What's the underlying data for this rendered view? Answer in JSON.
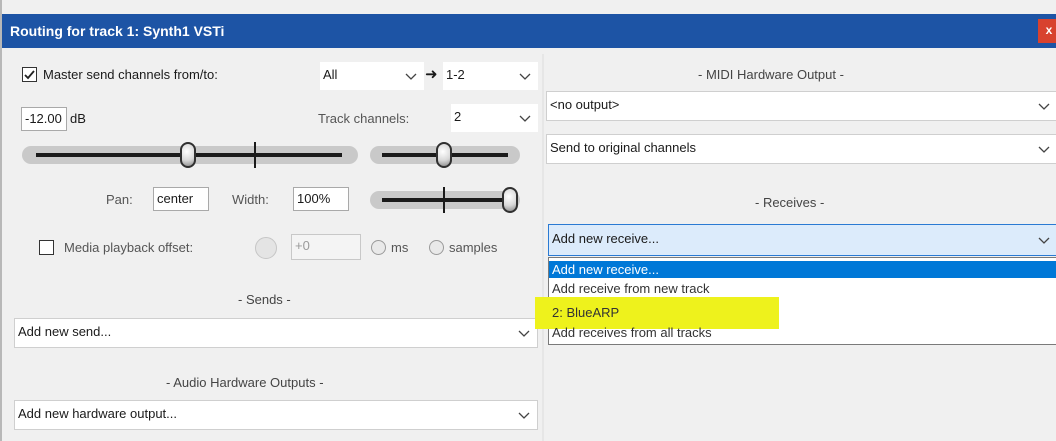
{
  "window": {
    "title": "Routing for track 1: Synth1 VSTi",
    "close_label": "x"
  },
  "master": {
    "checkbox_checked": true,
    "label": "Master send channels from/to:",
    "from_value": "All",
    "arrow": "➜",
    "to_value": "1-2"
  },
  "volume": {
    "value": "-12.00",
    "unit": "dB"
  },
  "track_channels": {
    "label": "Track channels:",
    "value": "2"
  },
  "pan": {
    "label": "Pan:",
    "value": "center",
    "width_label": "Width:",
    "width_value": "100%"
  },
  "media_offset": {
    "checkbox_checked": false,
    "label": "Media playback offset:",
    "value": "+0",
    "ms_label": "ms",
    "samples_label": "samples"
  },
  "sends": {
    "section_label": "- Sends -",
    "combo_value": "Add new send..."
  },
  "audio_hw": {
    "section_label": "- Audio Hardware Outputs -",
    "combo_value": "Add new hardware output..."
  },
  "midi_hw": {
    "section_label": "- MIDI Hardware Output -",
    "output_value": "<no output>",
    "channels_value": "Send to original channels"
  },
  "receives": {
    "section_label": "- Receives -",
    "combo_value": "Add new receive...",
    "options": [
      "Add new receive...",
      "Add receive from new track",
      "2: BlueARP",
      "Add receives from all tracks"
    ],
    "selected_index": 0,
    "highlighted_index": 2,
    "highlight_color": "#eef21c",
    "selection_color": "#0078d7"
  },
  "icons": {
    "chevron": "chevron-down-icon",
    "check": "checkmark-icon",
    "arrow": "arrow-right-icon",
    "close": "close-icon"
  }
}
